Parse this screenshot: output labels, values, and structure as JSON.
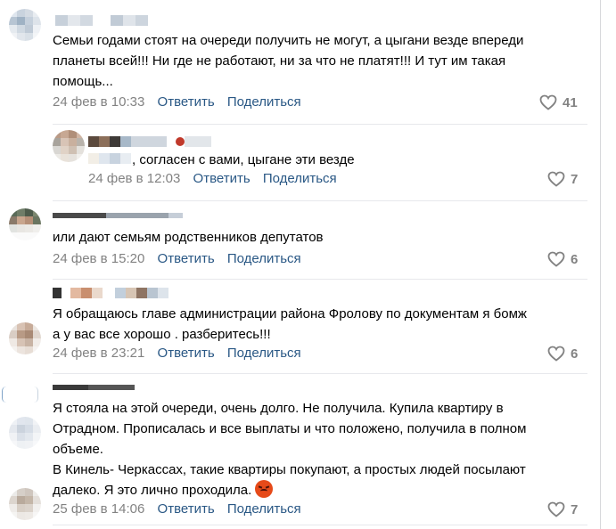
{
  "comments": [
    {
      "text_lines": [
        "Семьи годами стоят на очереди получить не могут, а цыгани везде впереди",
        "планеты всей!!! Ни где не работают, ни за что не платят!!! И тут им такая",
        "помощь..."
      ],
      "date": "24 фев в 10:33",
      "reply": "Ответить",
      "share": "Поделиться",
      "likes": "41"
    },
    {
      "text_lines": [
        ", согласен с вами, цыгане эти везде"
      ],
      "date": "24 фев в 12:03",
      "reply": "Ответить",
      "share": "Поделиться",
      "likes": "7"
    },
    {
      "text_lines": [
        "или дают семьям родственников депутатов"
      ],
      "date": "24 фев в 15:20",
      "reply": "Ответить",
      "share": "Поделиться",
      "likes": "6"
    },
    {
      "text_lines": [
        "Я обращаюсь главе администрации района Фролову по документам я бомж",
        "а у вас все хорошо . разберитесь!!!"
      ],
      "date": "24 фев в 23:21",
      "reply": "Ответить",
      "share": "Поделиться",
      "likes": "6"
    },
    {
      "text_lines": [
        "Я стояла на этой очереди, очень долго. Не получила. Купила квартиру в",
        "Отрадном. Прописалась и все выплаты и что положено, получила в полном",
        "объеме.",
        "В Кинель- Черкассах, такие квартиры покупают, а простых людей посылают",
        "далеко. Я это лично проходила."
      ],
      "date": "25 фев в 14:06",
      "reply": "Ответить",
      "share": "Поделиться",
      "likes": "7"
    }
  ],
  "icons": {
    "like": "heart-outline-icon",
    "emoji": "angry-face-emoji"
  },
  "colors": {
    "link": "#2a5885",
    "meta": "#828282",
    "separator": "#e7e8ec"
  }
}
